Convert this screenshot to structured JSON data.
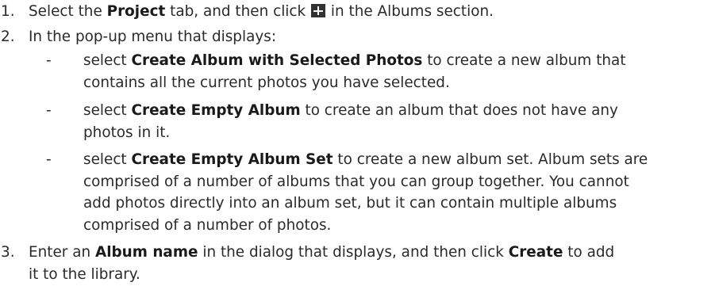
{
  "steps": [
    {
      "number": "1.",
      "pre": "Select the ",
      "bold1": "Project",
      "mid": " tab, and then click ",
      "icon": "add-plus-icon",
      "post": " in the Albums section."
    },
    {
      "number": "2.",
      "text": "In the pop-up menu that displays:",
      "bullets": [
        {
          "dash": "-",
          "pre": "select ",
          "bold": "Create Album with Selected Photos",
          "line1_post": " to create a new album that",
          "line2": "contains all the current photos you have selected."
        },
        {
          "dash": "-",
          "pre": "select ",
          "bold": "Create Empty Album",
          "line1_post": " to create an album that does not have any",
          "line2": "photos in it."
        },
        {
          "dash": "-",
          "pre": "select ",
          "bold": "Create Empty Album Set",
          "line1_post": " to create a new album set. Album sets are",
          "line2": "comprised of a number of albums that you can group together. You cannot",
          "line3": "add photos directly into an album set, but it can contain multiple albums",
          "line4": "comprised of a number of photos."
        }
      ]
    },
    {
      "number": "3.",
      "pre": "Enter an ",
      "bold1": "Album name",
      "mid": " in the dialog that displays, and then click ",
      "bold2": "Create",
      "post": " to add",
      "line2": "it to the library."
    }
  ]
}
